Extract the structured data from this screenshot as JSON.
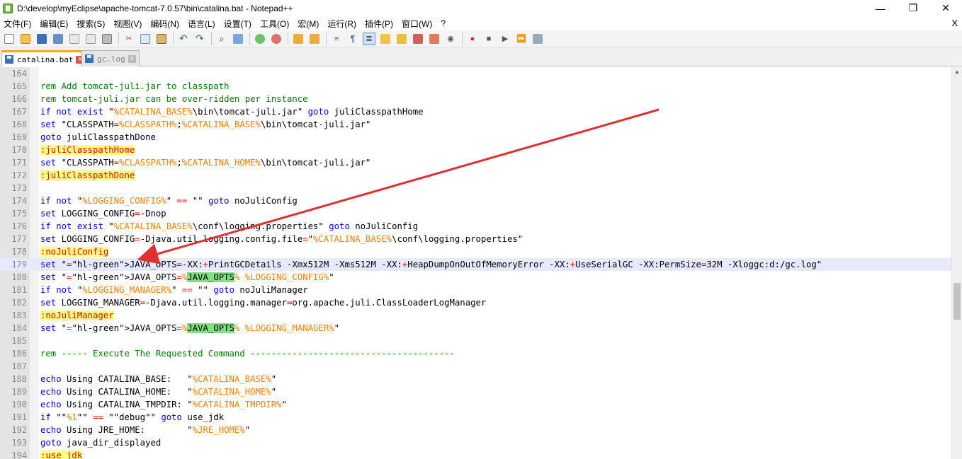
{
  "window": {
    "title": "D:\\develop\\myEclipse\\apache-tomcat-7.0.57\\bin\\catalina.bat - Notepad++",
    "minimize": "—",
    "restore": "❐",
    "close": "✕"
  },
  "menu": {
    "items": [
      "文件(F)",
      "编辑(E)",
      "搜索(S)",
      "视图(V)",
      "编码(N)",
      "语言(L)",
      "设置(T)",
      "工具(O)",
      "宏(M)",
      "运行(R)",
      "插件(P)",
      "窗口(W)",
      "?"
    ],
    "close": "X"
  },
  "toolbar": {
    "icons": [
      "new-file-icon",
      "open-file-icon",
      "save-icon",
      "save-all-icon",
      "close-icon",
      "close-all-icon",
      "print-icon",
      "cut-icon",
      "copy-icon",
      "paste-icon",
      "undo-icon",
      "redo-icon",
      "find-icon",
      "replace-icon",
      "zoom-in-icon",
      "zoom-out-icon",
      "sync-v-icon",
      "sync-h-icon",
      "word-wrap-icon",
      "show-all-chars-icon",
      "indent-guide-icon",
      "udl-icon",
      "doc-map-icon",
      "function-list-icon",
      "folder-as-workspace-icon",
      "monitor-icon",
      "record-macro-icon",
      "stop-macro-icon",
      "play-macro-icon",
      "run-macro-multiple-icon",
      "save-macro-icon"
    ]
  },
  "tabs": [
    {
      "label": "catalina.bat",
      "active": true
    },
    {
      "label": "gc.log",
      "active": false
    }
  ],
  "colors": {
    "keyword": "#0000ff",
    "comment": "#008000",
    "variable": "#ff8000",
    "label": "#ff0000",
    "label_bg": "#ffff80",
    "highlight": "#80e080",
    "arrow": "#e03030"
  },
  "editor": {
    "lines": [
      {
        "n": "164",
        "code": ""
      },
      {
        "n": "165",
        "code": "rem Add tomcat-juli.jar to classpath"
      },
      {
        "n": "166",
        "code": "rem tomcat-juli.jar can be over-ridden per instance"
      },
      {
        "n": "167",
        "code": "if not exist \"%CATALINA_BASE%\\bin\\tomcat-juli.jar\" goto juliClasspathHome"
      },
      {
        "n": "168",
        "code": "set \"CLASSPATH=%CLASSPATH%;%CATALINA_BASE%\\bin\\tomcat-juli.jar\""
      },
      {
        "n": "169",
        "code": "goto juliClasspathDone"
      },
      {
        "n": "170",
        "code": ":juliClasspathHome"
      },
      {
        "n": "171",
        "code": "set \"CLASSPATH=%CLASSPATH%;%CATALINA_HOME%\\bin\\tomcat-juli.jar\""
      },
      {
        "n": "172",
        "code": ":juliClasspathDone"
      },
      {
        "n": "173",
        "code": ""
      },
      {
        "n": "174",
        "code": "if not \"%LOGGING_CONFIG%\" == \"\" goto noJuliConfig"
      },
      {
        "n": "175",
        "code": "set LOGGING_CONFIG=-Dnop"
      },
      {
        "n": "176",
        "code": "if not exist \"%CATALINA_BASE%\\conf\\logging.properties\" goto noJuliConfig"
      },
      {
        "n": "177",
        "code": "set LOGGING_CONFIG=-Djava.util.logging.config.file=\"%CATALINA_BASE%\\conf\\logging.properties\""
      },
      {
        "n": "178",
        "code": ":noJuliConfig"
      },
      {
        "n": "179",
        "code": "set \"JAVA_OPTS=-XX:+PrintGCDetails -Xmx512M -Xms512M -XX:+HeapDumpOnOutOfMemoryError -XX:+UseSerialGC -XX:PermSize=32M -Xloggc:d:/gc.log\""
      },
      {
        "n": "180",
        "code": "set \"JAVA_OPTS=%JAVA_OPTS% %LOGGING_CONFIG%\""
      },
      {
        "n": "181",
        "code": "if not \"%LOGGING_MANAGER%\" == \"\" goto noJuliManager"
      },
      {
        "n": "182",
        "code": "set LOGGING_MANAGER=-Djava.util.logging.manager=org.apache.juli.ClassLoaderLogManager"
      },
      {
        "n": "183",
        "code": ":noJuliManager"
      },
      {
        "n": "184",
        "code": "set \"JAVA_OPTS=%JAVA_OPTS% %LOGGING_MANAGER%\""
      },
      {
        "n": "185",
        "code": ""
      },
      {
        "n": "186",
        "code": "rem ----- Execute The Requested Command ---------------------------------------"
      },
      {
        "n": "187",
        "code": ""
      },
      {
        "n": "188",
        "code": "echo Using CATALINA_BASE:   \"%CATALINA_BASE%\""
      },
      {
        "n": "189",
        "code": "echo Using CATALINA_HOME:   \"%CATALINA_HOME%\""
      },
      {
        "n": "190",
        "code": "echo Using CATALINA_TMPDIR: \"%CATALINA_TMPDIR%\""
      },
      {
        "n": "191",
        "code": "if \"\"%1\"\" == \"\"debug\"\" goto use_jdk"
      },
      {
        "n": "192",
        "code": "echo Using JRE_HOME:        \"%JRE_HOME%\""
      },
      {
        "n": "193",
        "code": "goto java_dir_displayed"
      },
      {
        "n": "194",
        "code": ":use_jdk"
      }
    ]
  }
}
